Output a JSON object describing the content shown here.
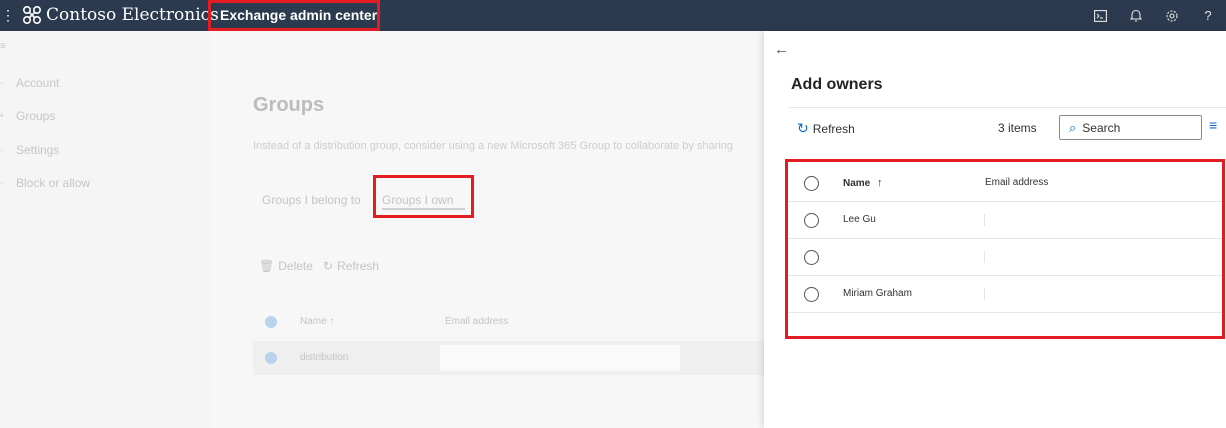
{
  "topbar": {
    "waffle_icon": "waffle-icon",
    "brand_name": "Contoso Electronics",
    "app_title": "Exchange admin center",
    "icons": [
      "terminal-icon",
      "bell-icon",
      "gear-icon",
      "help-icon"
    ],
    "help_glyph": "?"
  },
  "nav": {
    "items": [
      {
        "label": "Account",
        "icon": "person-icon"
      },
      {
        "label": "Groups",
        "icon": "people-icon"
      },
      {
        "label": "Settings",
        "icon": "gear-icon"
      },
      {
        "label": "Block or allow",
        "icon": "block-icon"
      }
    ]
  },
  "main": {
    "title": "Groups",
    "description": "Instead of a distribution group, consider using a new Microsoft 365 Group to collaborate by sharing",
    "tabs": [
      {
        "label": "Groups I belong to"
      },
      {
        "label": "Groups I own"
      }
    ],
    "commands": {
      "delete_label": "Delete",
      "refresh_label": "Refresh"
    },
    "table": {
      "headers": {
        "name": "Name",
        "email": "Email address"
      },
      "sort_glyph": "↑",
      "rows": [
        {
          "name": "distribution",
          "email": ""
        }
      ]
    }
  },
  "panel": {
    "title": "Add owners",
    "refresh_label": "Refresh",
    "item_count": "3 items",
    "search_placeholder": "Search",
    "table": {
      "headers": {
        "name": "Name",
        "email": "Email address"
      },
      "sort_glyph": "↑",
      "rows": [
        {
          "name": "Lee Gu",
          "email": ""
        },
        {
          "name": "",
          "email": ""
        },
        {
          "name": "Miriam Graham",
          "email": ""
        }
      ]
    }
  },
  "colors": {
    "topbar_bg": "#2b3a4e",
    "highlight_red": "#e31b23",
    "accent_blue": "#0f6cbd"
  }
}
